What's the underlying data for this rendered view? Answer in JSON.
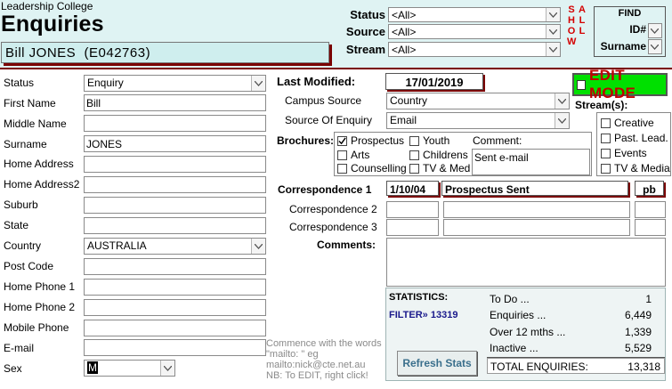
{
  "header": {
    "org": "Leadership College",
    "title": "Enquiries",
    "record_name": "Bill JONES  (E042763)",
    "filters": {
      "status_label": "Status",
      "status_value": "<All>",
      "source_label": "Source",
      "source_value": "<All>",
      "stream_label": "Stream",
      "stream_value": "<All>"
    },
    "show_letters": [
      "S",
      "H",
      "O",
      "W"
    ],
    "all_letters": [
      "A",
      "L",
      "L"
    ],
    "find": {
      "title": "FIND",
      "id_label": "ID#",
      "surname_label": "Surname"
    }
  },
  "form": {
    "status": {
      "label": "Status",
      "value": "Enquiry"
    },
    "first_name": {
      "label": "First Name",
      "value": "Bill"
    },
    "middle_name": {
      "label": "Middle Name",
      "value": ""
    },
    "surname": {
      "label": "Surname",
      "value": "JONES"
    },
    "home_address": {
      "label": "Home Address",
      "value": ""
    },
    "home_address2": {
      "label": "Home Address2",
      "value": ""
    },
    "suburb": {
      "label": "Suburb",
      "value": ""
    },
    "state": {
      "label": "State",
      "value": ""
    },
    "country": {
      "label": "Country",
      "value": "AUSTRALIA"
    },
    "post_code": {
      "label": "Post Code",
      "value": ""
    },
    "home_phone1": {
      "label": "Home Phone 1",
      "value": ""
    },
    "home_phone2": {
      "label": "Home Phone 2",
      "value": ""
    },
    "mobile_phone": {
      "label": "Mobile Phone",
      "value": ""
    },
    "email": {
      "label": "E-mail",
      "value": ""
    },
    "sex": {
      "label": "Sex",
      "value": "M"
    }
  },
  "email_hint": {
    "line1": "Commence with the words",
    "line2": "\"mailto: \" eg",
    "line3": "mailto:nick@cte.net.au",
    "line4": "NB: To EDIT, right click!"
  },
  "record": {
    "last_modified_label": "Last Modified:",
    "last_modified": "17/01/2019",
    "edit_mode_label": "EDIT MODE",
    "campus_source_label": "Campus Source",
    "campus_source": "Country",
    "source_of_enquiry_label": "Source Of Enquiry",
    "source_of_enquiry": "Email"
  },
  "streams": {
    "label": "Stream(s):",
    "items": [
      "Creative",
      "Past. Lead.",
      "Events",
      "TV & Media"
    ]
  },
  "brochures": {
    "label": "Brochures:",
    "items": [
      {
        "name": "Prospectus",
        "checked": true
      },
      {
        "name": "Youth",
        "checked": false
      },
      {
        "name": "Arts",
        "checked": false
      },
      {
        "name": "Childrens",
        "checked": false
      },
      {
        "name": "Counselling",
        "checked": false
      },
      {
        "name": "TV & Media",
        "checked": false
      }
    ],
    "comment_label": "Comment:",
    "comment": "Sent e-mail"
  },
  "correspondence": [
    {
      "label": "Correspondence 1",
      "date": "1/10/04",
      "text": "Prospectus Sent",
      "by": "pb"
    },
    {
      "label": "Correspondence 2",
      "date": "",
      "text": "",
      "by": ""
    },
    {
      "label": "Correspondence 3",
      "date": "",
      "text": "",
      "by": ""
    }
  ],
  "comments": {
    "label": "Comments:",
    "value": ""
  },
  "stats": {
    "title": "STATISTICS:",
    "filter_label": "FILTER» 13319",
    "refresh_label": "Refresh Stats",
    "rows": [
      {
        "label": "To Do ...",
        "value": "1"
      },
      {
        "label": "Enquiries ...",
        "value": "6,449"
      },
      {
        "label": "Over 12 mths ...",
        "value": "1,339"
      },
      {
        "label": "Inactive ...",
        "value": "5,529"
      }
    ],
    "total_label": "TOTAL ENQUIRIES:",
    "total_value": "13,318"
  },
  "colors": {
    "header_bg": "#dff3f3",
    "accent_dark_red": "#7a0000",
    "edit_mode_bg": "#00e000",
    "edit_mode_text": "#c00000",
    "show_all_text": "#d40000",
    "filter_text": "#1a1a8c"
  }
}
